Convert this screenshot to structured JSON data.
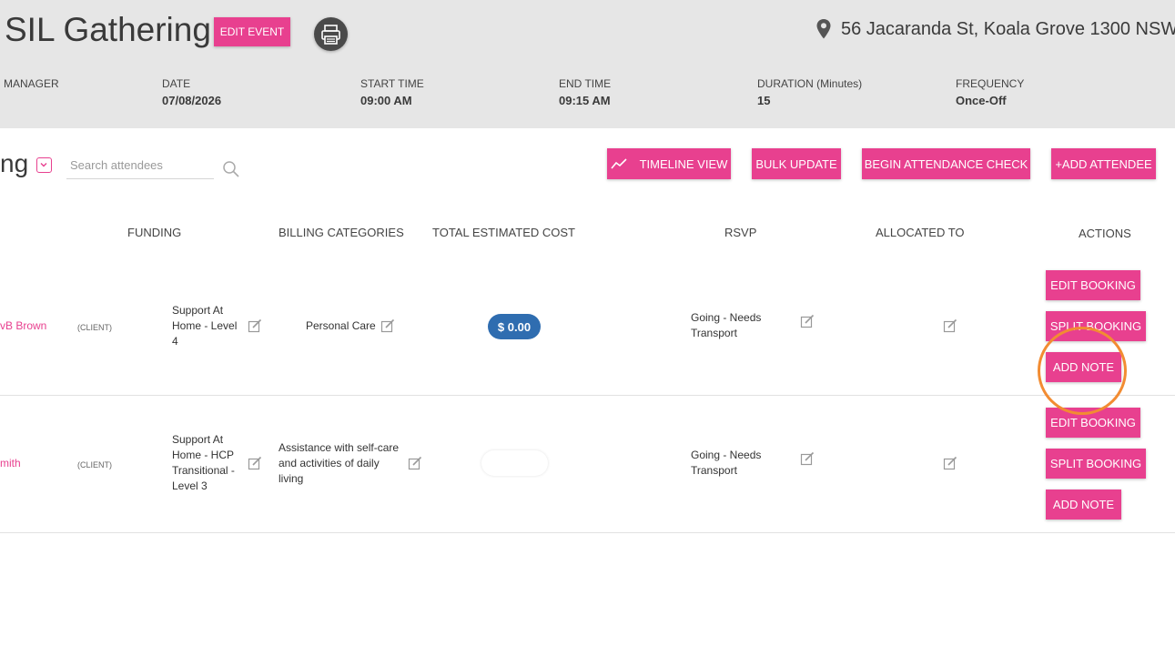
{
  "header": {
    "title": "SIL Gathering",
    "edit_event_label": "EDIT EVENT",
    "address": "56 Jacaranda St, Koala Grove 1300 NSW",
    "meta": {
      "manager_label": "MANAGER",
      "date_label": "DATE",
      "date_value": "07/08/2026",
      "start_label": "START TIME",
      "start_value": "09:00 AM",
      "end_label": "END TIME",
      "end_value": "09:15 AM",
      "duration_label": "DURATION (Minutes)",
      "duration_value": "15",
      "frequency_label": "FREQUENCY",
      "frequency_value": "Once-Off"
    }
  },
  "toolbar": {
    "heading_fragment": "ng",
    "search_placeholder": "Search attendees",
    "timeline_label": "TIMELINE VIEW",
    "bulk_update_label": "BULK UPDATE",
    "attendance_label": "BEGIN ATTENDANCE CHECK",
    "add_attendee_label": "+ADD ATTENDEE"
  },
  "table": {
    "columns": {
      "funding": "FUNDING",
      "billing": "BILLING CATEGORIES",
      "cost": "TOTAL ESTIMATED COST",
      "rsvp": "RSVP",
      "allocated": "ALLOCATED TO",
      "actions": "ACTIONS"
    },
    "rows": [
      {
        "name": "vB Brown",
        "type": "(CLIENT)",
        "funding": [
          "Support At",
          "Home - Level",
          "4"
        ],
        "billing": [
          "Personal Care"
        ],
        "cost": "$ 0.00",
        "rsvp": [
          "Going - Needs",
          "Transport"
        ],
        "actions": {
          "edit": "EDIT BOOKING",
          "split": "SPLIT BOOKING",
          "note": "ADD NOTE"
        }
      },
      {
        "name": "mith",
        "type": "(CLIENT)",
        "funding": [
          "Support At",
          "Home - HCP",
          "Transitional -",
          "Level 3"
        ],
        "billing": [
          "Assistance with self-care",
          "and activities of daily",
          "living"
        ],
        "cost": "",
        "rsvp": [
          "Going - Needs",
          "Transport"
        ],
        "actions": {
          "edit": "EDIT BOOKING",
          "split": "SPLIT BOOKING",
          "note": "ADD NOTE"
        }
      }
    ]
  },
  "colors": {
    "accent": "#e8408f",
    "cost_pill": "#2f6db0",
    "highlight": "#f28c32",
    "header_bg": "#e6e6e6"
  },
  "icons": [
    "printer-icon",
    "location-pin-icon",
    "chevron-down-icon",
    "search-icon",
    "timeline-icon",
    "edit-icon"
  ]
}
